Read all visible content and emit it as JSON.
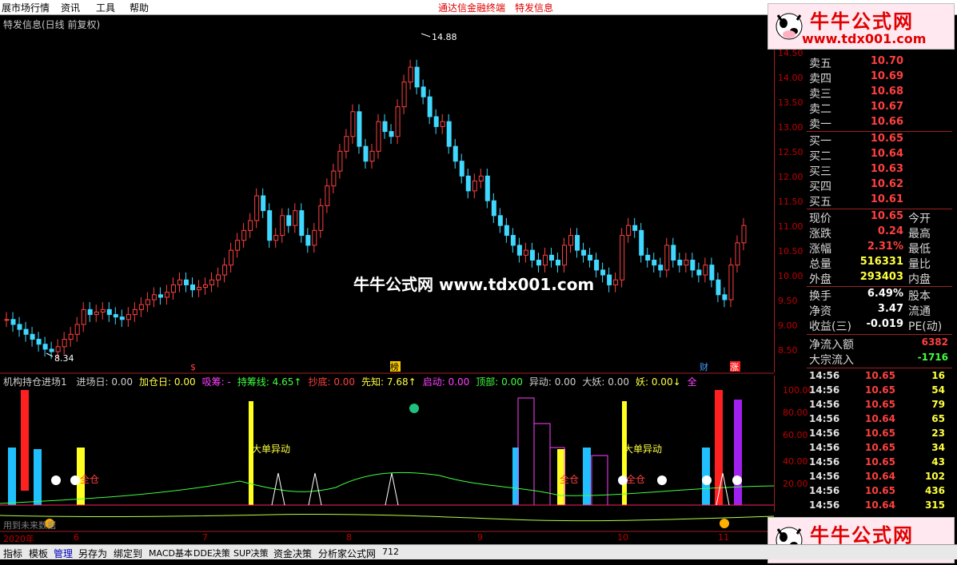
{
  "menubar": {
    "items": [
      "展市场行情",
      "资讯",
      "工具",
      "帮助"
    ],
    "links": [
      "通达信金融终端",
      "特发信息"
    ]
  },
  "chart": {
    "title": "特发信息(日线 前复权)",
    "high_label": "14.88",
    "low_label": "8.34",
    "price_ticks": [
      "14.50",
      "14.00",
      "13.50",
      "13.00",
      "12.50",
      "12.00",
      "11.50",
      "11.00",
      "10.50",
      "10.00",
      "9.50",
      "9.00",
      "8.50"
    ],
    "markers": [
      "$",
      "榜",
      "财",
      "涨"
    ]
  },
  "watermark": "牛牛公式网 www.tdx001.com",
  "logo": {
    "title": "牛牛公式网",
    "url": "www.tdx001.com"
  },
  "quote": {
    "rows_top": [
      {
        "label": "卖五",
        "value": "10.70"
      },
      {
        "label": "卖四",
        "value": "10.69"
      },
      {
        "label": "卖三",
        "value": "10.68"
      },
      {
        "label": "卖二",
        "value": "10.67"
      },
      {
        "label": "卖一",
        "value": "10.66"
      }
    ],
    "rows_bid": [
      {
        "label": "买一",
        "value": "10.65"
      },
      {
        "label": "买二",
        "value": "10.64"
      },
      {
        "label": "买三",
        "value": "10.63"
      },
      {
        "label": "买四",
        "value": "10.62"
      },
      {
        "label": "买五",
        "value": "10.61"
      }
    ],
    "stats": [
      {
        "label": "现价",
        "value": "10.65",
        "label2": "今开"
      },
      {
        "label": "涨跌",
        "value": "0.24",
        "label2": "最高"
      },
      {
        "label": "涨幅",
        "value": "2.31%",
        "label2": "最低"
      },
      {
        "label": "总量",
        "value": "516331",
        "label2": "量比"
      },
      {
        "label": "外盘",
        "value": "293403",
        "label2": "内盘"
      }
    ],
    "stats2": [
      {
        "label": "换手",
        "value": "6.49%",
        "label2": "股本"
      },
      {
        "label": "净资",
        "value": "3.47",
        "label2": "流通"
      },
      {
        "label": "收益(三)",
        "value": "-0.019",
        "label2": "PE(动)"
      }
    ],
    "flow": [
      {
        "label": "净流入额",
        "value": "6382"
      },
      {
        "label": "大宗流入",
        "value": "-1716"
      }
    ],
    "ticks": [
      {
        "time": "14:56",
        "price": "10.65",
        "vol": "16"
      },
      {
        "time": "14:56",
        "price": "10.65",
        "vol": "54"
      },
      {
        "time": "14:56",
        "price": "10.65",
        "vol": "79"
      },
      {
        "time": "14:56",
        "price": "10.64",
        "vol": "65"
      },
      {
        "time": "14:56",
        "price": "10.65",
        "vol": "23"
      },
      {
        "time": "14:56",
        "price": "10.65",
        "vol": "34"
      },
      {
        "time": "14:56",
        "price": "10.65",
        "vol": "43"
      },
      {
        "time": "14:56",
        "price": "10.64",
        "vol": "102"
      },
      {
        "time": "14:56",
        "price": "10.65",
        "vol": "436"
      },
      {
        "time": "14:56",
        "price": "10.64",
        "vol": "315"
      }
    ]
  },
  "indicator": {
    "name": "机构持仓进场1",
    "parts": [
      {
        "text": "进场日: 0.00",
        "color": "#d0d0d0"
      },
      {
        "text": "加仓日: 0.00",
        "color": "#ffff40"
      },
      {
        "text": "吸筹: -",
        "color": "#ff40ff"
      },
      {
        "text": "持筹线: 4.65↑",
        "color": "#40ff40"
      },
      {
        "text": "抄底: 0.00",
        "color": "#ff4040"
      },
      {
        "text": "先知: 7.68↑",
        "color": "#ffff40"
      },
      {
        "text": "启动: 0.00",
        "color": "#ff40ff"
      },
      {
        "text": "顶部: 0.00",
        "color": "#40ff40"
      },
      {
        "text": "异动: 0.00",
        "color": "#d0d0d0"
      },
      {
        "text": "大妖: 0.00",
        "color": "#d0d0d0"
      },
      {
        "text": "妖: 0.00↓",
        "color": "#ffff40"
      },
      {
        "text": "全",
        "color": "#ff40ff"
      }
    ],
    "ticks": [
      "100.00",
      "80.00",
      "60.00",
      "40.00",
      "20.00"
    ],
    "labels": [
      "大单异动",
      "大单异动",
      "全仓",
      "全仓",
      "全仓"
    ],
    "footnote": "用到未来数据"
  },
  "dates": [
    "2020年",
    "6",
    "7",
    "8",
    "9",
    "10",
    "11"
  ],
  "bottom_tabs": [
    "指标",
    "模板",
    "管理",
    "另存为",
    "绑定到",
    "MACD基本",
    "DDE决策",
    "SUP决策",
    "资金决策",
    "分析家公式网",
    "712"
  ]
}
